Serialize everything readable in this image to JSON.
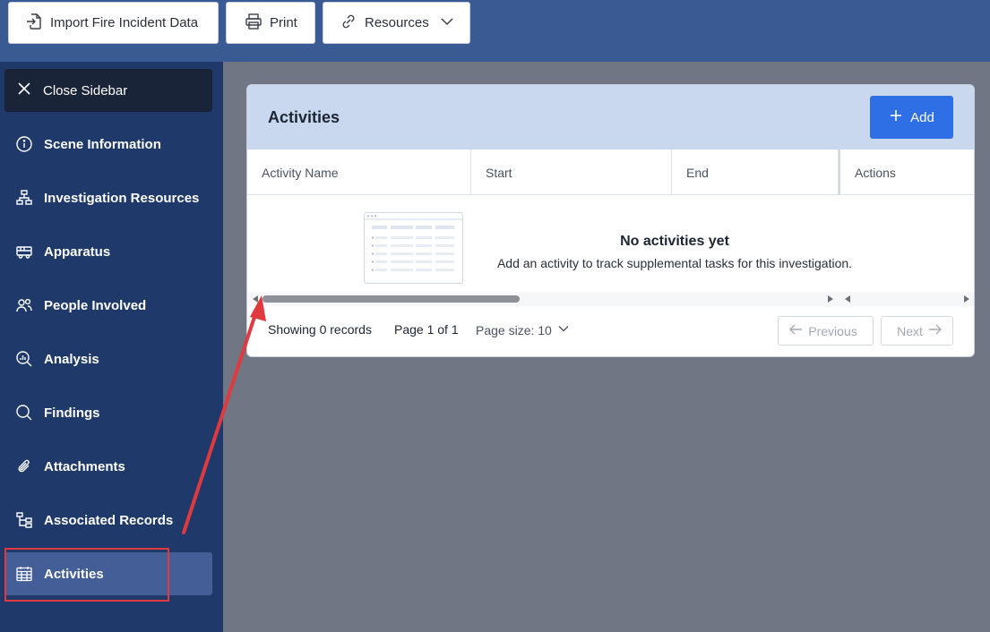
{
  "toolbar": {
    "import_label": "Import Fire Incident Data",
    "print_label": "Print",
    "resources_label": "Resources"
  },
  "sidebar": {
    "close_label": "Close Sidebar",
    "items": [
      {
        "label": "Scene Information",
        "icon": "info-icon"
      },
      {
        "label": "Investigation Resources",
        "icon": "org-chart-icon"
      },
      {
        "label": "Apparatus",
        "icon": "fire-truck-icon"
      },
      {
        "label": "People Involved",
        "icon": "people-icon"
      },
      {
        "label": "Analysis",
        "icon": "analysis-icon"
      },
      {
        "label": "Findings",
        "icon": "search-icon"
      },
      {
        "label": "Attachments",
        "icon": "paperclip-icon"
      },
      {
        "label": "Associated Records",
        "icon": "hierarchy-icon"
      },
      {
        "label": "Activities",
        "icon": "calendar-icon",
        "active": true
      }
    ]
  },
  "panel": {
    "title": "Activities",
    "add_label": "Add",
    "columns": [
      "Activity Name",
      "Start",
      "End",
      "Actions"
    ],
    "empty_title": "No activities yet",
    "empty_text": "Add an activity to track supplemental tasks for this investigation."
  },
  "pagination": {
    "showing": "Showing 0 records",
    "page": "Page 1 of 1",
    "page_size": "Page size: 10",
    "previous": "Previous",
    "next": "Next"
  },
  "colors": {
    "topbar": "#3a5a93",
    "sidebar": "#1f3a6a",
    "accent": "#2f6fe5",
    "annotation": "#e0393e"
  }
}
